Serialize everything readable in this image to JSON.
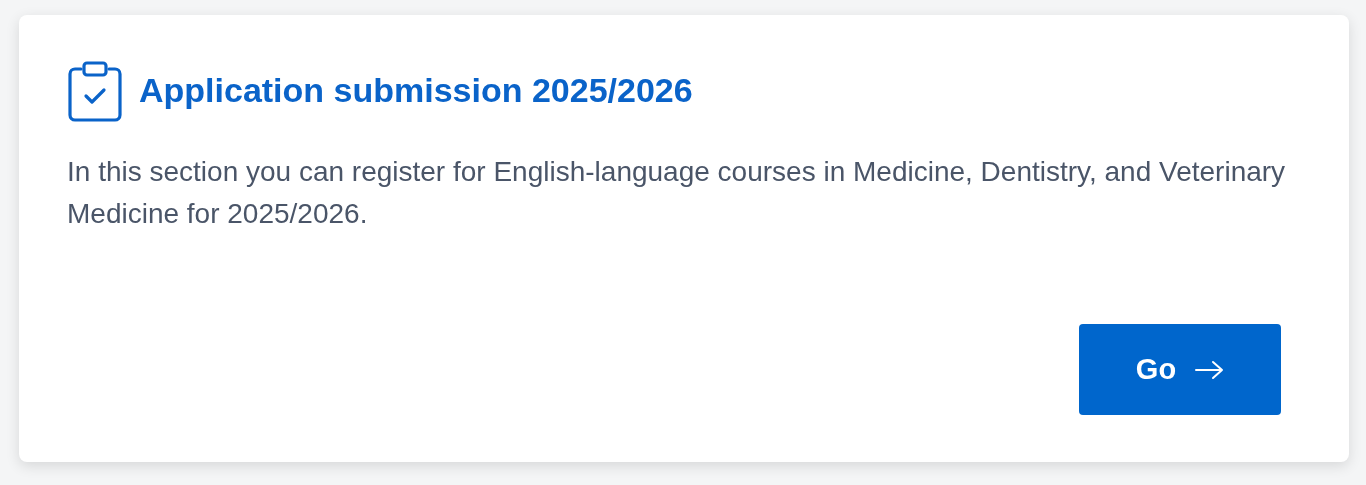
{
  "card": {
    "title": "Application submission 2025/2026",
    "description": "In this section you can register for English-language courses in Medicine, Dentistry, and Veterinary Medicine for 2025/2026.",
    "button": {
      "label": "Go"
    }
  }
}
